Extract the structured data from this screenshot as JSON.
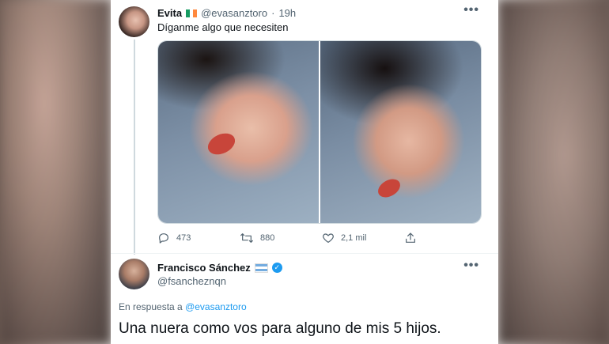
{
  "tweet1": {
    "author_name": "Evita",
    "author_handle": "@evasanztoro",
    "time": "19h",
    "text": "Díganme algo que necesiten",
    "stats": {
      "replies": "473",
      "retweets": "880",
      "likes": "2,1 mil"
    },
    "flag_colors": [
      "#169b62",
      "#ffffff",
      "#ff883e"
    ]
  },
  "tweet2": {
    "author_name": "Francisco Sánchez",
    "author_handle": "@fsancheznqn",
    "reply_prefix": "En respuesta a",
    "reply_to": "@evasanztoro",
    "text": "Una nuera como vos para alguno de mis 5 hijos.",
    "flag_colors": [
      "#74acdf",
      "#ffffff",
      "#74acdf"
    ]
  },
  "icons": {
    "reply": "reply-icon",
    "retweet": "retweet-icon",
    "like": "heart-icon",
    "share": "share-icon",
    "more": "more-icon",
    "verified": "verified-icon"
  },
  "colors": {
    "accent": "#1d9bf0",
    "text": "#0f1419",
    "muted": "#536471"
  },
  "glyphs": {
    "more": "•••",
    "verified": "✓"
  }
}
